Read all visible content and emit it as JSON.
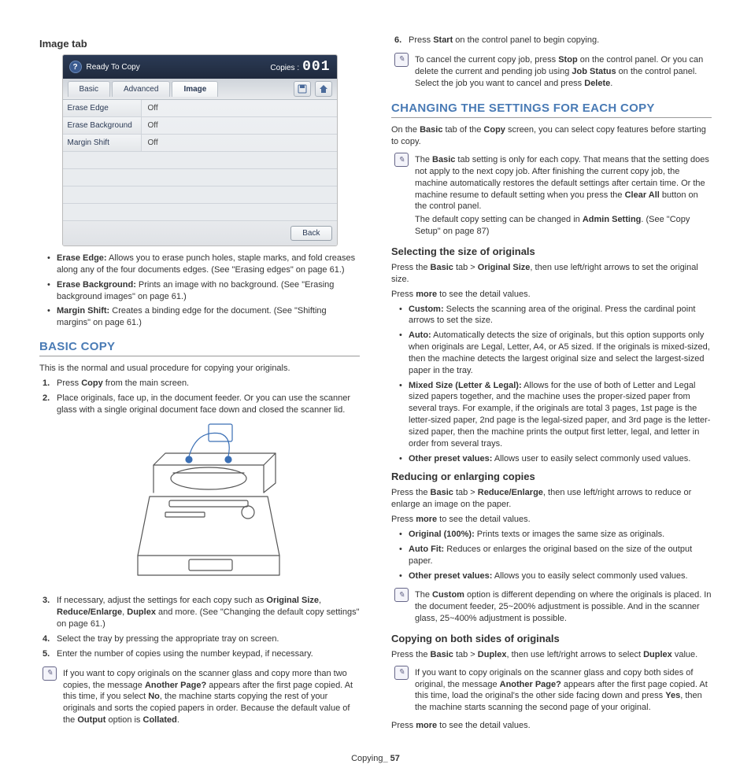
{
  "left": {
    "image_tab_heading": "Image tab",
    "ui": {
      "title": "Ready To Copy",
      "copies_label": "Copies :",
      "copies_value": "001",
      "tabs": {
        "basic": "Basic",
        "advanced": "Advanced",
        "image": "Image"
      },
      "rows": [
        {
          "label": "Erase Edge",
          "value": "Off"
        },
        {
          "label": "Erase Background",
          "value": "Off"
        },
        {
          "label": "Margin Shift",
          "value": "Off"
        }
      ],
      "back": "Back"
    },
    "image_bullets": {
      "erase_edge_label": "Erase Edge:",
      "erase_edge_text": "  Allows you to erase punch holes, staple marks, and fold creases along any of the four documents edges. (See \"Erasing edges\" on page 61.)",
      "erase_bg_label": "Erase Background:",
      "erase_bg_text": "  Prints an image with no background. (See \"Erasing background images\" on page 61.)",
      "margin_shift_label": "Margin Shift:",
      "margin_shift_text": "  Creates a binding edge for the document. (See \"Shifting margins\" on page 61.)"
    },
    "basic_copy_heading": "Basic Copy",
    "basic_copy_intro": "This is the normal and usual procedure for copying your originals.",
    "steps": {
      "s1a": "Press ",
      "s1b": "Copy",
      "s1c": " from the main screen.",
      "s2": "Place originals, face up, in the document feeder. Or you can use the scanner glass with a single original document face down and closed the scanner lid.",
      "s3a": "If necessary, adjust the settings for each copy such as ",
      "s3b": "Original Size",
      "s3c": ", ",
      "s3d": "Reduce/Enlarge",
      "s3e": ", ",
      "s3f": "Duplex",
      "s3g": " and more. (See \"Changing the default copy settings\" on page 61.)",
      "s4": "Select the tray by pressing the appropriate tray on screen.",
      "s5": "Enter the number of copies using the number keypad, if necessary."
    },
    "note": {
      "a": "If you want to copy originals on the scanner glass and copy more than two copies, the message ",
      "b": "Another Page?",
      "c": " appears after the first page copied. At this time, if you select ",
      "d": "No",
      "e": ", the machine starts copying the rest of your originals and sorts the copied papers in order. Because the default value of the ",
      "f": "Output",
      "g": " option is ",
      "h": "Collated",
      "i": "."
    }
  },
  "right": {
    "step6": {
      "a": "Press ",
      "b": "Start",
      "c": " on the control panel to begin copying."
    },
    "note1": {
      "a": "To cancel the current copy job, press ",
      "b": "Stop",
      "c": " on the control panel. Or you can delete the current and pending job using ",
      "d": "Job Status",
      "e": " on the control panel. Select the job you want to cancel and press ",
      "f": "Delete",
      "g": "."
    },
    "changing_heading": "Changing the Settings for Each Copy",
    "changing_intro": {
      "a": "On the ",
      "b": "Basic",
      "c": " tab of the ",
      "d": "Copy",
      "e": " screen, you can select copy features before starting to copy."
    },
    "note2": {
      "a": "The ",
      "b": "Basic",
      "c": " tab setting is only for each copy. That means that the setting does not apply to the next copy job. After finishing the current copy job, the machine automatically restores the default settings after certain time. Or the machine resume to default setting when you press the ",
      "d": "Clear All",
      "e": " button on the control panel.",
      "p2a": "The default copy setting can be changed in ",
      "p2b": "Admin Setting",
      "p2c": ". (See \"Copy Setup\" on page 87)"
    },
    "sel_heading": "Selecting the size of originals",
    "sel_intro": {
      "a": "Press the ",
      "b": "Basic",
      "c": " tab > ",
      "d": "Original Size",
      "e": ", then use left/right arrows to set the original size."
    },
    "sel_more": {
      "a": "Press ",
      "b": "more",
      "c": " to see the detail values."
    },
    "sel_bullets": {
      "custom_l": "Custom:",
      "custom_t": "  Selects the scanning area of the original. Press the cardinal point arrows to set the size.",
      "auto_l": "Auto:",
      "auto_t": "  Automatically detects the size of originals, but this option supports only when originals are Legal, Letter, A4, or A5 sized. If the originals is mixed-sized, then the machine detects the largest original size and select the largest-sized paper in the tray.",
      "mixed_l": "Mixed Size (Letter & Legal):",
      "mixed_t": "  Allows for the use of both of Letter and Legal sized papers together, and the machine uses the proper-sized paper from several trays. For example, if the originals are total 3 pages, 1st page is the letter-sized paper, 2nd page is the legal-sized paper, and 3rd page is the letter-sized paper, then the machine prints the output first letter, legal, and letter in order from several trays.",
      "other_l": "Other preset values:",
      "other_t": "  Allows user to easily select commonly used values."
    },
    "red_heading": "Reducing or enlarging copies",
    "red_intro": {
      "a": "Press the ",
      "b": "Basic",
      "c": " tab > ",
      "d": "Reduce/Enlarge",
      "e": ", then use left/right arrows to reduce or enlarge an image on the paper."
    },
    "red_more": {
      "a": "Press ",
      "b": "more",
      "c": " to see the detail values."
    },
    "red_bullets": {
      "orig_l": "Original (100%):",
      "orig_t": "  Prints texts or images the same size as originals.",
      "auto_l": "Auto Fit:",
      "auto_t": "  Reduces or enlarges the original based on the size of the output paper.",
      "other_l": "Other preset values:",
      "other_t": "  Allows you to easily select commonly used values."
    },
    "note3": {
      "a": "The ",
      "b": "Custom",
      "c": " option is different depending on where the originals is placed. In the document feeder, 25~200% adjustment is possible. And in the scanner glass, 25~400% adjustment is possible."
    },
    "dup_heading": "Copying on both sides of originals",
    "dup_intro": {
      "a": "Press the ",
      "b": "Basic",
      "c": " tab > ",
      "d": "Duplex",
      "e": ", then use left/right arrows to select ",
      "f": "Duplex",
      "g": " value."
    },
    "note4": {
      "a": "If you want to copy originals on the scanner glass and copy both sides of original, the message ",
      "b": "Another Page?",
      "c": " appears after the first page copied. At this time, load the original's the other side facing down and press ",
      "d": "Yes",
      "e": ", then the machine starts scanning the second page of your original."
    },
    "dup_more": {
      "a": "Press ",
      "b": "more",
      "c": " to see the detail values."
    }
  },
  "footer": {
    "a": "Copying",
    "b": "_ 57"
  }
}
